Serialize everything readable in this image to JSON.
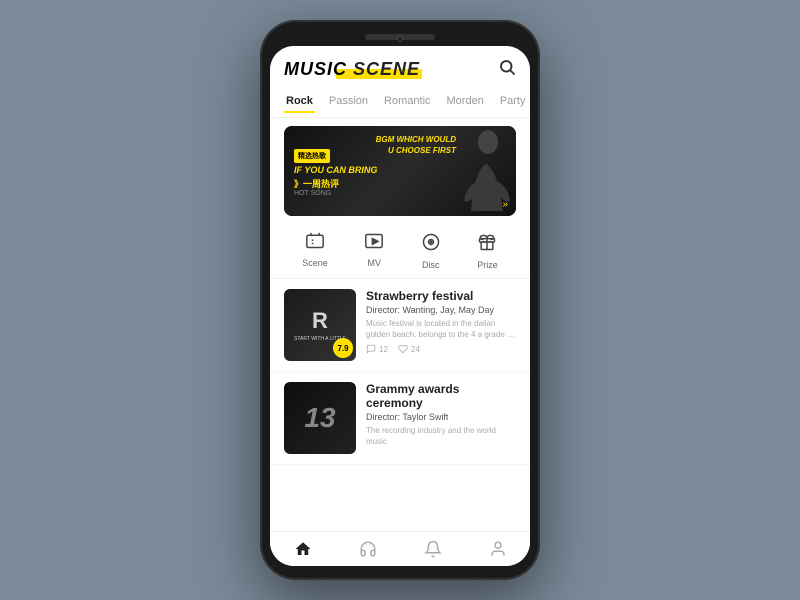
{
  "app": {
    "title": "MUSIC SCENE",
    "title_part1": "MUSIC ",
    "title_part2": "SCENE"
  },
  "header": {
    "search_label": "search"
  },
  "nav": {
    "tabs": [
      {
        "id": "rock",
        "label": "Rock",
        "active": true
      },
      {
        "id": "passion",
        "label": "Passion",
        "active": false
      },
      {
        "id": "romantic",
        "label": "Romantic",
        "active": false
      },
      {
        "id": "morden",
        "label": "Morden",
        "active": false
      },
      {
        "id": "party",
        "label": "Party",
        "active": false
      }
    ]
  },
  "banner": {
    "tag": "精选热歌",
    "line1": "IF YOU CAN BRING",
    "line2": "BGM WHICH WOULD",
    "line3": "U CHOOSE FIRST",
    "week_label": "》一周热评",
    "hot_label": "HOT SONG",
    "chevron": "»"
  },
  "quick_links": [
    {
      "id": "scene",
      "icon": "🎫",
      "label": "Scene"
    },
    {
      "id": "mv",
      "icon": "▶",
      "label": "MV"
    },
    {
      "id": "disc",
      "icon": "💿",
      "label": "Disc"
    },
    {
      "id": "prize",
      "icon": "🎁",
      "label": "Prize"
    }
  ],
  "items": [
    {
      "id": "strawberry",
      "title": "Strawberry festival",
      "director_label": "Director:",
      "director": " Wanting, Jay, May Day",
      "description": "Music festival is located in the dalian golden beach, belongs to the 4 a grade of ...",
      "rating": "7.9",
      "thumb_letter": "R",
      "thumb_sub": "START WITH A LITTLE",
      "comments": "12",
      "likes": "24"
    },
    {
      "id": "grammy",
      "title": "Grammy awards ceremony",
      "director_label": "Director:",
      "director": " Taylor Swift",
      "description": "The recording industry and the world music",
      "rating": "",
      "thumb_number": "13",
      "comments": "",
      "likes": ""
    }
  ],
  "bottom_nav": [
    {
      "id": "home",
      "icon": "🏠",
      "active": true
    },
    {
      "id": "headphones",
      "icon": "🎧",
      "active": false
    },
    {
      "id": "bell",
      "icon": "🔔",
      "active": false
    },
    {
      "id": "user",
      "icon": "👤",
      "active": false
    }
  ]
}
